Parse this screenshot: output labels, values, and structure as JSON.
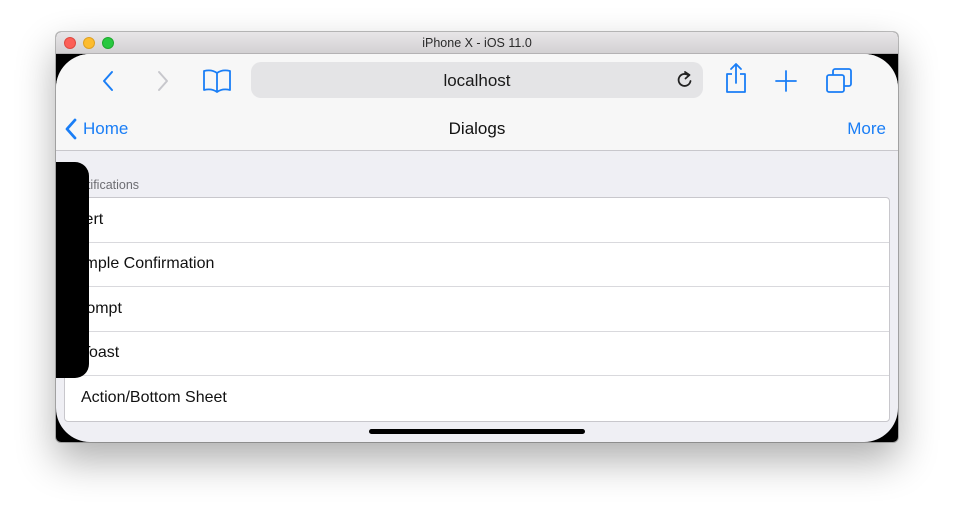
{
  "window": {
    "title": "iPhone X - iOS 11.0"
  },
  "safari": {
    "url": "localhost",
    "icons": [
      "chevron-left-icon",
      "chevron-right-icon",
      "bookmarks-icon",
      "reload-icon",
      "share-icon",
      "plus-icon",
      "tabs-icon"
    ]
  },
  "navbar": {
    "back_label": "Home",
    "title": "Dialogs",
    "right_label": "More"
  },
  "section": {
    "header": "otifications"
  },
  "items": [
    {
      "label": "lert"
    },
    {
      "label": "imple Confirmation"
    },
    {
      "label": "rompt"
    },
    {
      "label": "Toast"
    },
    {
      "label": "Action/Bottom Sheet"
    }
  ],
  "colors": {
    "accent": "#1a7ef6",
    "close": "#fc5f57",
    "minimize": "#fdbc2e",
    "maximize": "#28c840"
  }
}
